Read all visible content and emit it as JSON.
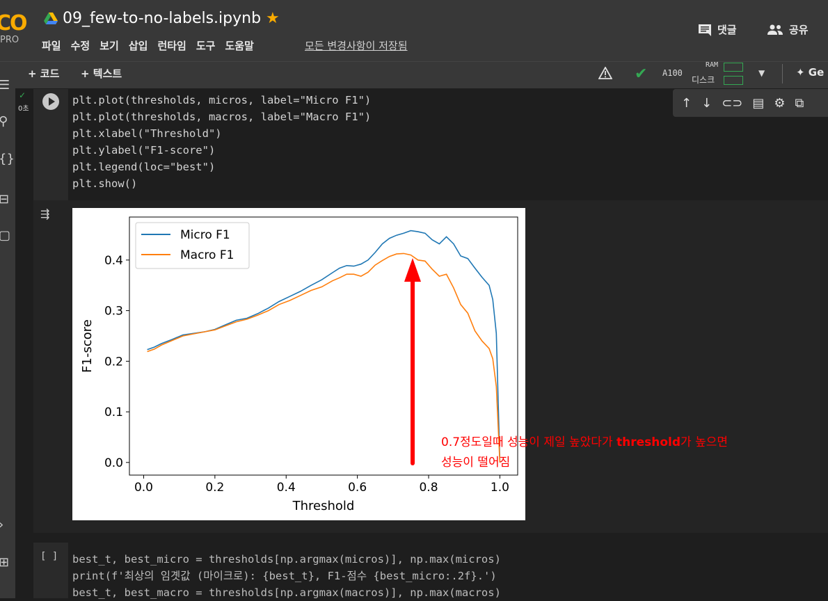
{
  "header": {
    "logo_text": "CO",
    "logo_sub": "PRO",
    "title": "09_few-to-no-labels.ipynb",
    "menu": [
      "파일",
      "수정",
      "보기",
      "삽입",
      "런타임",
      "도구",
      "도움말"
    ],
    "saved_status": "모든 변경사항이 저장됨",
    "comment_label": "댓글",
    "share_label": "공유"
  },
  "toolbar": {
    "add_code": "+ 코드",
    "add_text": "+ 텍스트",
    "gpu": "A100",
    "ram_label": "RAM",
    "disk_label": "디스크",
    "gemini_label": "✦ Ge"
  },
  "cell1": {
    "exec_time": "0초",
    "lines": [
      "plt.plot(thresholds, micros, label=\"Micro F1\")",
      "plt.plot(thresholds, macros, label=\"Macro F1\")",
      "plt.xlabel(\"Threshold\")",
      "plt.ylabel(\"F1-score\")",
      "plt.legend(loc=\"best\")",
      "plt.show()"
    ]
  },
  "chart_data": {
    "type": "line",
    "title": "",
    "xlabel": "Threshold",
    "ylabel": "F1-score",
    "xlim": [
      -0.04,
      1.05
    ],
    "ylim": [
      -0.025,
      0.485
    ],
    "xticks": [
      0.0,
      0.2,
      0.4,
      0.6,
      0.8,
      1.0
    ],
    "xtick_labels": [
      "0.0",
      "0.2",
      "0.4",
      "0.6",
      "0.8",
      "1.0"
    ],
    "yticks": [
      0.0,
      0.1,
      0.2,
      0.3,
      0.4
    ],
    "ytick_labels": [
      "0.0",
      "0.1",
      "0.2",
      "0.3",
      "0.4"
    ],
    "legend_position": "upper-left",
    "series": [
      {
        "name": "Micro F1",
        "color": "#1f77b4",
        "x": [
          0.01,
          0.03,
          0.05,
          0.08,
          0.11,
          0.14,
          0.17,
          0.2,
          0.23,
          0.26,
          0.29,
          0.32,
          0.35,
          0.38,
          0.41,
          0.44,
          0.47,
          0.5,
          0.53,
          0.55,
          0.57,
          0.59,
          0.61,
          0.63,
          0.65,
          0.67,
          0.69,
          0.71,
          0.73,
          0.75,
          0.77,
          0.79,
          0.81,
          0.83,
          0.85,
          0.87,
          0.89,
          0.91,
          0.93,
          0.95,
          0.97,
          0.98,
          0.99,
          1.0
        ],
        "y": [
          0.223,
          0.228,
          0.235,
          0.243,
          0.252,
          0.255,
          0.258,
          0.263,
          0.272,
          0.281,
          0.285,
          0.294,
          0.305,
          0.318,
          0.328,
          0.338,
          0.35,
          0.361,
          0.375,
          0.384,
          0.389,
          0.388,
          0.392,
          0.4,
          0.415,
          0.432,
          0.443,
          0.449,
          0.453,
          0.458,
          0.456,
          0.453,
          0.44,
          0.432,
          0.446,
          0.432,
          0.408,
          0.403,
          0.384,
          0.366,
          0.35,
          0.322,
          0.255,
          0.0
        ]
      },
      {
        "name": "Macro F1",
        "color": "#ff7f0e",
        "x": [
          0.01,
          0.03,
          0.05,
          0.08,
          0.11,
          0.14,
          0.17,
          0.2,
          0.23,
          0.26,
          0.29,
          0.32,
          0.35,
          0.38,
          0.41,
          0.44,
          0.47,
          0.5,
          0.53,
          0.55,
          0.57,
          0.59,
          0.61,
          0.63,
          0.65,
          0.67,
          0.69,
          0.71,
          0.73,
          0.75,
          0.77,
          0.79,
          0.81,
          0.83,
          0.85,
          0.87,
          0.89,
          0.91,
          0.93,
          0.95,
          0.97,
          0.98,
          0.99,
          1.0
        ],
        "y": [
          0.219,
          0.224,
          0.232,
          0.241,
          0.25,
          0.254,
          0.258,
          0.262,
          0.27,
          0.278,
          0.283,
          0.291,
          0.3,
          0.312,
          0.32,
          0.33,
          0.34,
          0.347,
          0.359,
          0.365,
          0.372,
          0.372,
          0.368,
          0.376,
          0.39,
          0.399,
          0.407,
          0.412,
          0.413,
          0.41,
          0.4,
          0.398,
          0.382,
          0.368,
          0.372,
          0.345,
          0.312,
          0.295,
          0.26,
          0.24,
          0.225,
          0.205,
          0.15,
          0.0
        ]
      }
    ]
  },
  "annotation": {
    "line1_prefix": "0.7",
    "line1_mid": "정도일때 성능이 제일 높았다가 ",
    "line1_bold": "threshold",
    "line1_suffix": "가 높으면",
    "line2": "성능이 떨어짐",
    "color": "#ff0000"
  },
  "cell2": {
    "bracket": "[ ]",
    "lines": [
      "best_t, best_micro = thresholds[np.argmax(micros)], np.max(micros)",
      "print(f'최상의 임곗값 (마이크로): {best_t}, F1-점수 {best_micro:.2f}.')",
      "best_t, best_macro = thresholds[np.argmax(macros)], np.max(macros)"
    ]
  }
}
